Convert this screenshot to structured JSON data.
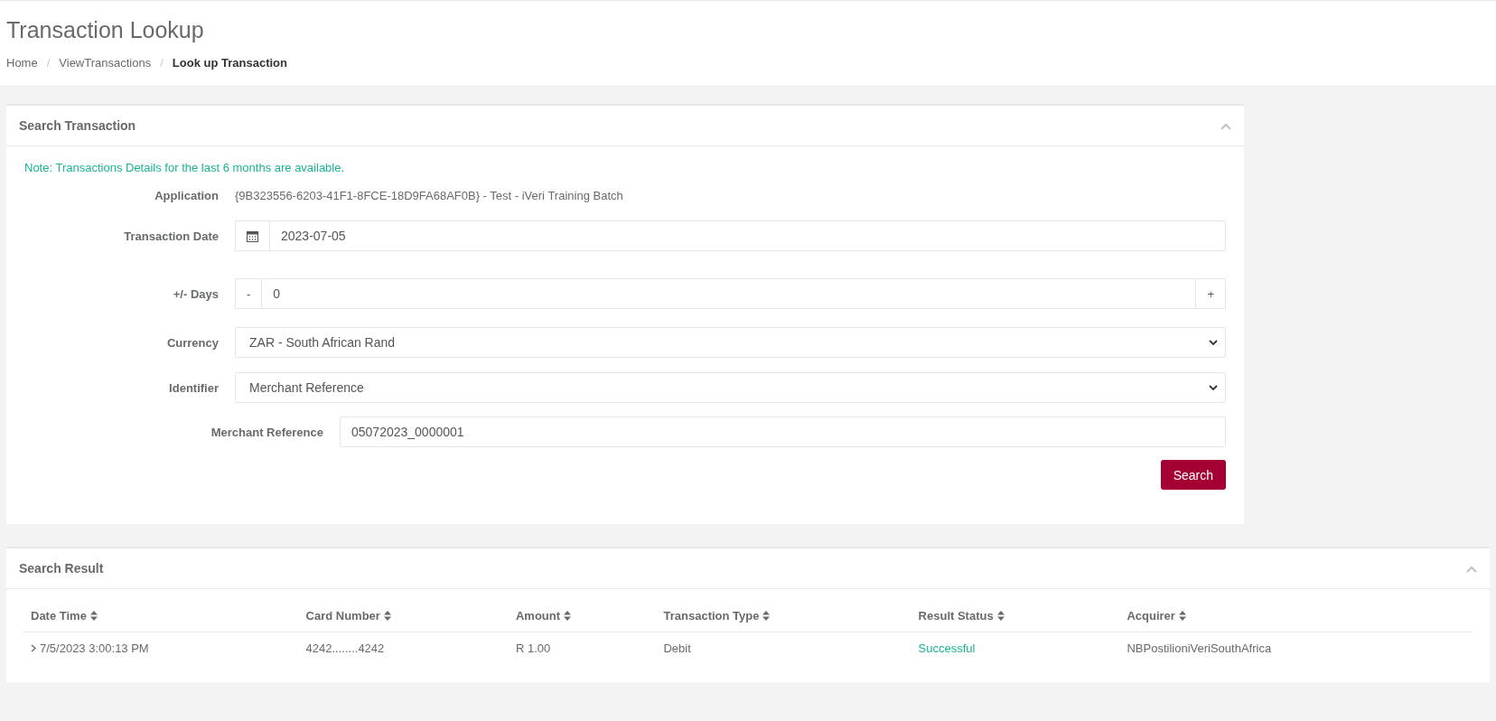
{
  "page": {
    "title": "Transaction Lookup",
    "breadcrumb_separator": "/",
    "breadcrumb": [
      {
        "label": "Home",
        "current": false
      },
      {
        "label": "ViewTransactions",
        "current": false
      },
      {
        "label": "Look up Transaction",
        "current": true
      }
    ]
  },
  "search_panel": {
    "title": "Search Transaction",
    "expanded": true,
    "note": "Note: Transactions Details for the last 6 months are available.",
    "fields": [
      {
        "kind": "text",
        "label": "Application",
        "value": "{9B323556-6203-41F1-8FCE-18D9FA68AF0B} - Test - iVeri Training Batch"
      },
      {
        "kind": "date",
        "label": "Transaction Date",
        "value": "2023-07-05"
      },
      {
        "kind": "stepper",
        "label": "+/- Days",
        "value": "0",
        "minus": "-",
        "plus": "+"
      },
      {
        "kind": "select",
        "label": "Currency",
        "value": "ZAR - South African Rand"
      },
      {
        "kind": "select",
        "label": "Identifier",
        "value": "Merchant Reference"
      },
      {
        "kind": "input",
        "label": "Merchant Reference",
        "value": "05072023_0000001"
      }
    ],
    "button": "Search"
  },
  "result_panel": {
    "title": "Search Result",
    "expanded": true,
    "columns": [
      "Date Time",
      "Card Number",
      "Amount",
      "Transaction Type",
      "Result Status",
      "Acquirer"
    ],
    "rows": [
      {
        "expanded": false,
        "cells": [
          "7/5/2023 3:00:13 PM",
          "4242........4242",
          "R 1.00",
          "Debit",
          "Successful",
          "NBPostilioniVeriSouthAfrica"
        ],
        "color": "#1ab394"
      }
    ]
  }
}
